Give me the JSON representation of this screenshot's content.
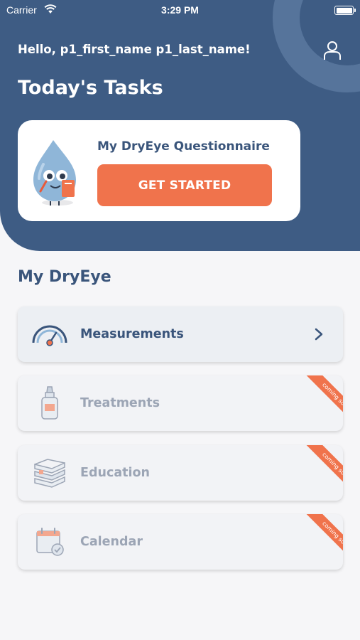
{
  "status_bar": {
    "carrier": "Carrier",
    "time": "3:29 PM"
  },
  "header": {
    "greeting": "Hello, p1_first_name p1_last_name!",
    "title": "Today's Tasks"
  },
  "task_card": {
    "title": "My DryEye Questionnaire",
    "button_label": "GET STARTED"
  },
  "section": {
    "title": "My DryEye"
  },
  "menu": [
    {
      "label": "Measurements",
      "icon": "gauge-icon",
      "enabled": true
    },
    {
      "label": "Treatments",
      "icon": "eye-drop-bottle-icon",
      "enabled": false,
      "badge": "coming soon"
    },
    {
      "label": "Education",
      "icon": "books-icon",
      "enabled": false,
      "badge": "coming soon"
    },
    {
      "label": "Calendar",
      "icon": "calendar-check-icon",
      "enabled": false,
      "badge": "coming soon"
    }
  ],
  "colors": {
    "header_bg": "#3e5c84",
    "accent": "#f0734c",
    "title_text": "#3a557b",
    "disabled_text": "#9ca5b5",
    "page_bg": "#f6f6f8"
  }
}
